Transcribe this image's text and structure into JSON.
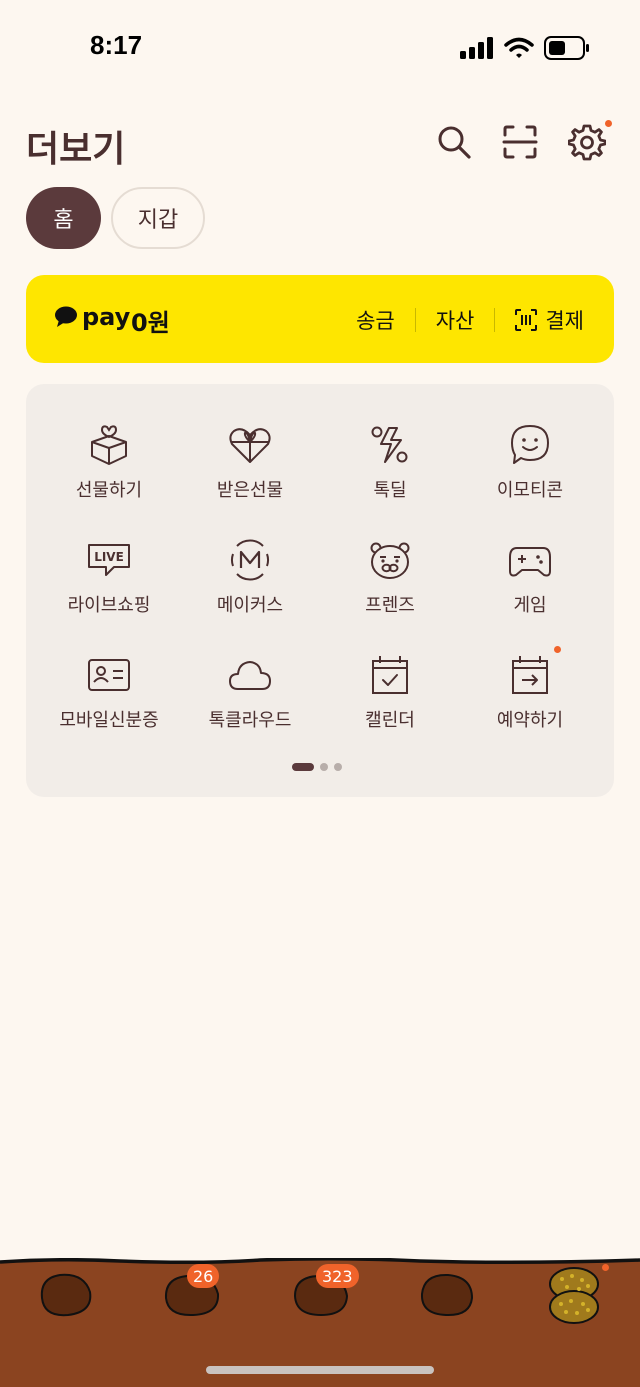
{
  "status": {
    "time": "8:17"
  },
  "header": {
    "title": "더보기"
  },
  "segments": {
    "home": "홈",
    "wallet": "지갑"
  },
  "pay": {
    "logo": "pay",
    "amount": "0원",
    "actions": [
      "송금",
      "자산",
      "결제"
    ]
  },
  "menu": {
    "items": [
      {
        "label": "선물하기",
        "icon": "gift-box-icon"
      },
      {
        "label": "받은선물",
        "icon": "heart-gift-icon"
      },
      {
        "label": "톡딜",
        "icon": "percent-bolt-icon"
      },
      {
        "label": "이모티콘",
        "icon": "smile-emoticon-icon"
      },
      {
        "label": "라이브쇼핑",
        "icon": "live-bubble-icon"
      },
      {
        "label": "메이커스",
        "icon": "makers-m-icon"
      },
      {
        "label": "프렌즈",
        "icon": "ryan-friends-icon"
      },
      {
        "label": "게임",
        "icon": "gamepad-icon"
      },
      {
        "label": "모바일신분증",
        "icon": "id-card-icon"
      },
      {
        "label": "톡클라우드",
        "icon": "cloud-icon"
      },
      {
        "label": "캘린더",
        "icon": "calendar-check-icon"
      },
      {
        "label": "예약하기",
        "icon": "calendar-arrow-icon"
      }
    ],
    "page_count": 3,
    "current_page": 1
  },
  "tabbar": {
    "badges": {
      "tab2": "26",
      "tab3": "323"
    }
  },
  "colors": {
    "accent": "#fee600",
    "brown": "#5b3a3c",
    "badge": "#f0632a",
    "ground": "#8b4420"
  }
}
